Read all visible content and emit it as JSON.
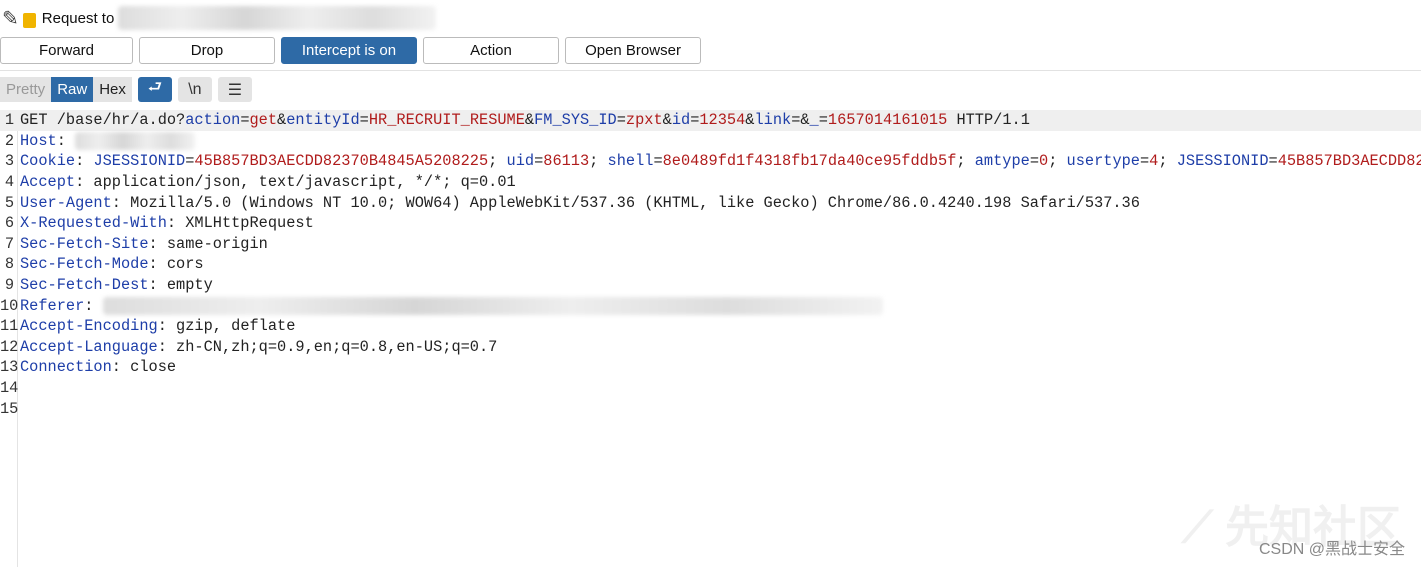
{
  "title": {
    "label": "Request to",
    "host_redacted": true
  },
  "buttons": {
    "forward": "Forward",
    "drop": "Drop",
    "intercept": "Intercept is on",
    "action": "Action",
    "open_browser": "Open Browser"
  },
  "view_tabs": {
    "pretty": "Pretty",
    "raw": "Raw",
    "hex": "Hex",
    "newline": "\\n",
    "wrap_icon": "wrap-icon",
    "menu_icon": "menu-icon"
  },
  "accent": "#2e6aa6",
  "request_lines": [
    [
      [
        "p",
        "GET /base/hr/a.do?"
      ],
      [
        "n",
        "action"
      ],
      [
        "p",
        "="
      ],
      [
        "v",
        "get"
      ],
      [
        "p",
        "&"
      ],
      [
        "n",
        "entityId"
      ],
      [
        "p",
        "="
      ],
      [
        "v",
        "HR_RECRUIT_RESUME"
      ],
      [
        "p",
        "&"
      ],
      [
        "n",
        "FM_SYS_ID"
      ],
      [
        "p",
        "="
      ],
      [
        "v",
        "zpxt"
      ],
      [
        "p",
        "&"
      ],
      [
        "n",
        "id"
      ],
      [
        "p",
        "="
      ],
      [
        "v",
        "12354"
      ],
      [
        "p",
        "&"
      ],
      [
        "n",
        "link"
      ],
      [
        "p",
        "=&"
      ],
      [
        "n",
        "_"
      ],
      [
        "p",
        "="
      ],
      [
        "v",
        "1657014161015"
      ],
      [
        "p",
        " HTTP/1.1"
      ]
    ],
    [
      [
        "n",
        "Host"
      ],
      [
        "p",
        ": "
      ],
      [
        "blur",
        "120"
      ]
    ],
    [
      [
        "n",
        "Cookie"
      ],
      [
        "p",
        ": "
      ],
      [
        "n",
        "JSESSIONID"
      ],
      [
        "p",
        "="
      ],
      [
        "v",
        "45B857BD3AECDD82370B4845A5208225"
      ],
      [
        "p",
        "; "
      ],
      [
        "n",
        "uid"
      ],
      [
        "p",
        "="
      ],
      [
        "v",
        "86113"
      ],
      [
        "p",
        "; "
      ],
      [
        "n",
        "shell"
      ],
      [
        "p",
        "="
      ],
      [
        "v",
        "8e0489fd1f4318fb17da40ce95fddb5f"
      ],
      [
        "p",
        "; "
      ],
      [
        "n",
        "amtype"
      ],
      [
        "p",
        "="
      ],
      [
        "v",
        "0"
      ],
      [
        "p",
        "; "
      ],
      [
        "n",
        "usertype"
      ],
      [
        "p",
        "="
      ],
      [
        "v",
        "4"
      ],
      [
        "p",
        "; "
      ],
      [
        "n",
        "JSESSIONID"
      ],
      [
        "p",
        "="
      ],
      [
        "v",
        "45B857BD3AECDD82"
      ]
    ],
    [
      [
        "n",
        "Accept"
      ],
      [
        "p",
        ": application/json, text/javascript, */*; q=0.01"
      ]
    ],
    [
      [
        "n",
        "User-Agent"
      ],
      [
        "p",
        ": Mozilla/5.0 (Windows NT 10.0; WOW64) AppleWebKit/537.36 (KHTML, like Gecko) Chrome/86.0.4240.198 Safari/537.36"
      ]
    ],
    [
      [
        "n",
        "X-Requested-With"
      ],
      [
        "p",
        ": XMLHttpRequest"
      ]
    ],
    [
      [
        "n",
        "Sec-Fetch-Site"
      ],
      [
        "p",
        ": same-origin"
      ]
    ],
    [
      [
        "n",
        "Sec-Fetch-Mode"
      ],
      [
        "p",
        ": cors"
      ]
    ],
    [
      [
        "n",
        "Sec-Fetch-Dest"
      ],
      [
        "p",
        ": empty"
      ]
    ],
    [
      [
        "n",
        "Referer"
      ],
      [
        "p",
        ": "
      ],
      [
        "blur",
        "780"
      ]
    ],
    [
      [
        "n",
        "Accept-Encoding"
      ],
      [
        "p",
        ": gzip, deflate"
      ]
    ],
    [
      [
        "n",
        "Accept-Language"
      ],
      [
        "p",
        ": zh-CN,zh;q=0.9,en;q=0.8,en-US;q=0.7"
      ]
    ],
    [
      [
        "n",
        "Connection"
      ],
      [
        "p",
        ": close"
      ]
    ],
    [],
    []
  ],
  "watermark": "CSDN @黑战士安全"
}
